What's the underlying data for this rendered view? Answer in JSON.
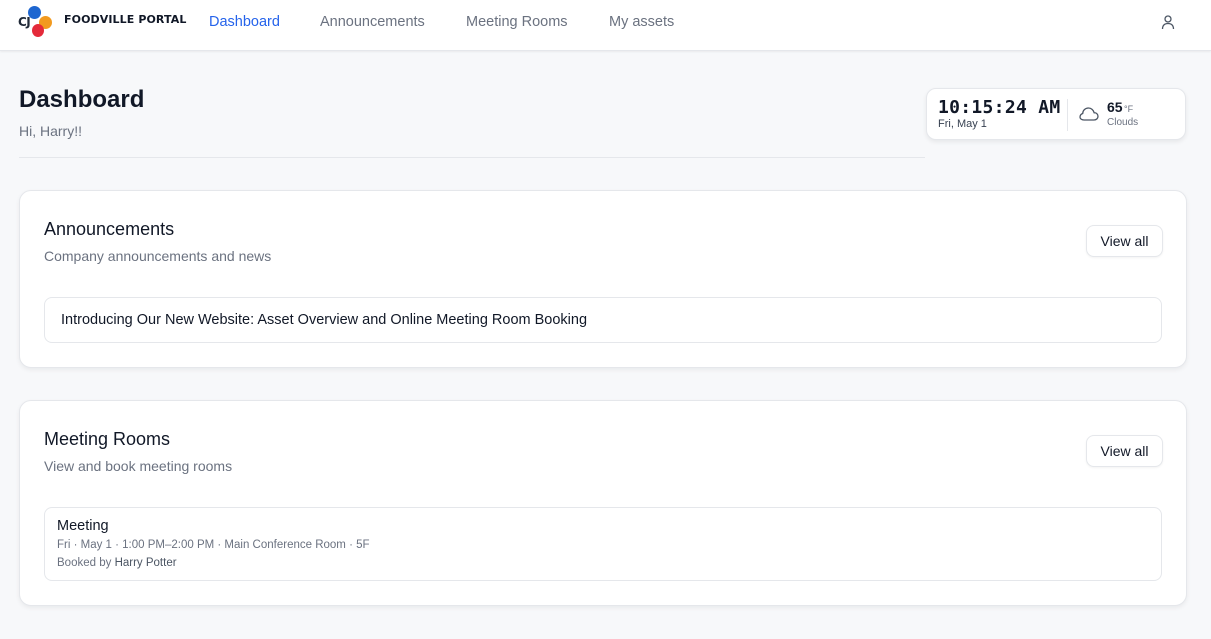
{
  "brand": {
    "logo_text": "CJ",
    "name": "FOODVILLE PORTAL"
  },
  "nav": {
    "items": [
      {
        "label": "Dashboard",
        "active": true
      },
      {
        "label": "Announcements",
        "active": false
      },
      {
        "label": "Meeting Rooms",
        "active": false
      },
      {
        "label": "My assets",
        "active": false
      }
    ],
    "user_icon": "user-icon"
  },
  "header": {
    "title": "Dashboard",
    "greeting": "Hi, Harry!!"
  },
  "clock": {
    "time": "10:15:24 AM",
    "date": "Fri, May 1",
    "weather_icon": "cloud-icon",
    "temperature": "65",
    "unit": "°F",
    "condition": "Clouds"
  },
  "announcements": {
    "title": "Announcements",
    "subtitle": "Company announcements and news",
    "view_all_label": "View all",
    "items": [
      {
        "title": "Introducing Our New Website: Asset Overview and Online Meeting Room Booking"
      }
    ]
  },
  "meeting_rooms": {
    "title": "Meeting Rooms",
    "subtitle": "View and book meeting rooms",
    "view_all_label": "View all",
    "items": [
      {
        "title": "Meeting",
        "details": "Fri · May 1 · 1:00 PM–2:00 PM · Main Conference Room · 5F",
        "booked_by_label": "Booked by",
        "booked_by": "Harry Potter"
      }
    ]
  },
  "colors": {
    "accent": "#2563eb",
    "background": "#f7f8fa",
    "logo_blue": "#1e66d0",
    "logo_orange": "#f29a1f",
    "logo_red": "#e42a3a"
  }
}
